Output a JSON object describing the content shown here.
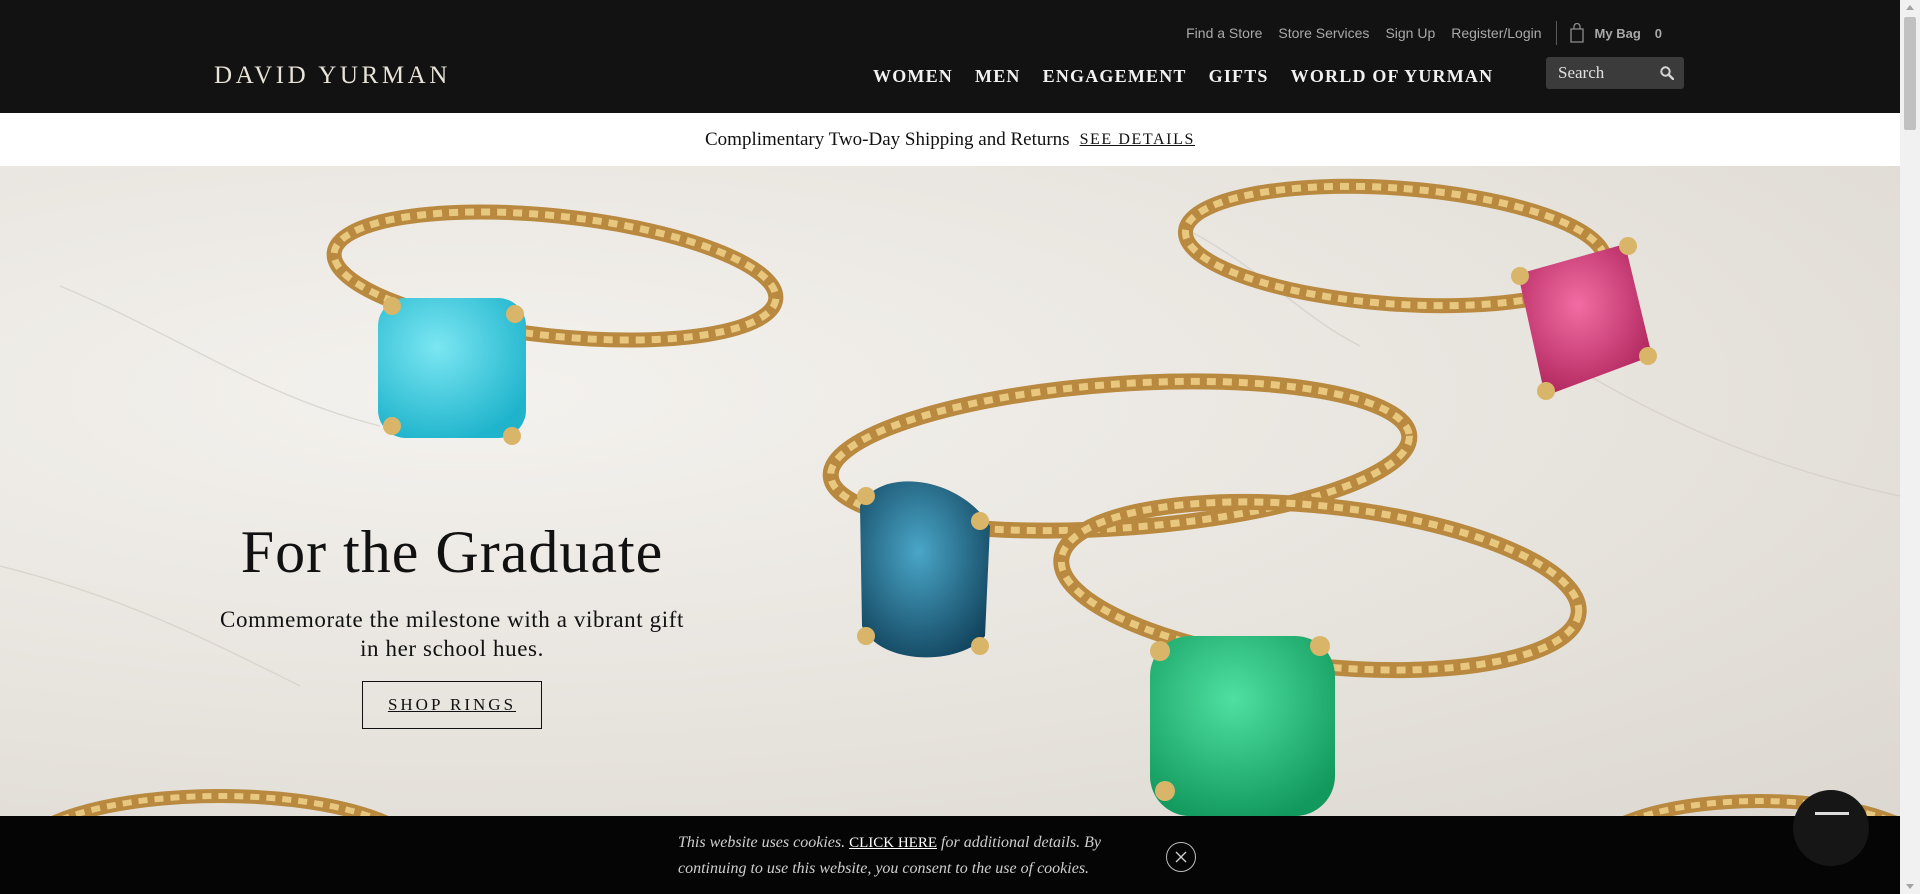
{
  "header": {
    "logo": "DAVID YURMAN",
    "utility_links": [
      "Find a Store",
      "Store Services",
      "Sign Up",
      "Register/Login"
    ],
    "bag": {
      "label": "My Bag",
      "count": "0",
      "icon": "shopping-bag-icon"
    },
    "nav": [
      "WOMEN",
      "MEN",
      "ENGAGEMENT",
      "GIFTS",
      "WORLD OF YURMAN"
    ],
    "search": {
      "placeholder": "Search",
      "icon": "search-icon"
    }
  },
  "promo": {
    "text": "Complimentary Two-Day Shipping and Returns",
    "link": "SEE DETAILS"
  },
  "hero": {
    "title": "For the Graduate",
    "subtitle": "Commemorate the milestone with a vibrant gift in her school hues.",
    "button": "SHOP RINGS",
    "gem_colors": {
      "turquoise": "#3fc9dc",
      "pink": "#d0316f",
      "blue": "#1f6d90",
      "green": "#22b574",
      "gold": "#c9a25a"
    }
  },
  "cookie": {
    "text_before": "This website uses cookies.",
    "link": "CLICK HERE",
    "text_after": "for additional details. By continuing to use this website, you consent to the use of cookies.",
    "close_icon": "close-icon"
  },
  "chat": {
    "icon": "chat-icon"
  },
  "colors": {
    "header_bg": "#121212",
    "cookie_bg": "#050505",
    "accent_text": "#e9e4da"
  }
}
